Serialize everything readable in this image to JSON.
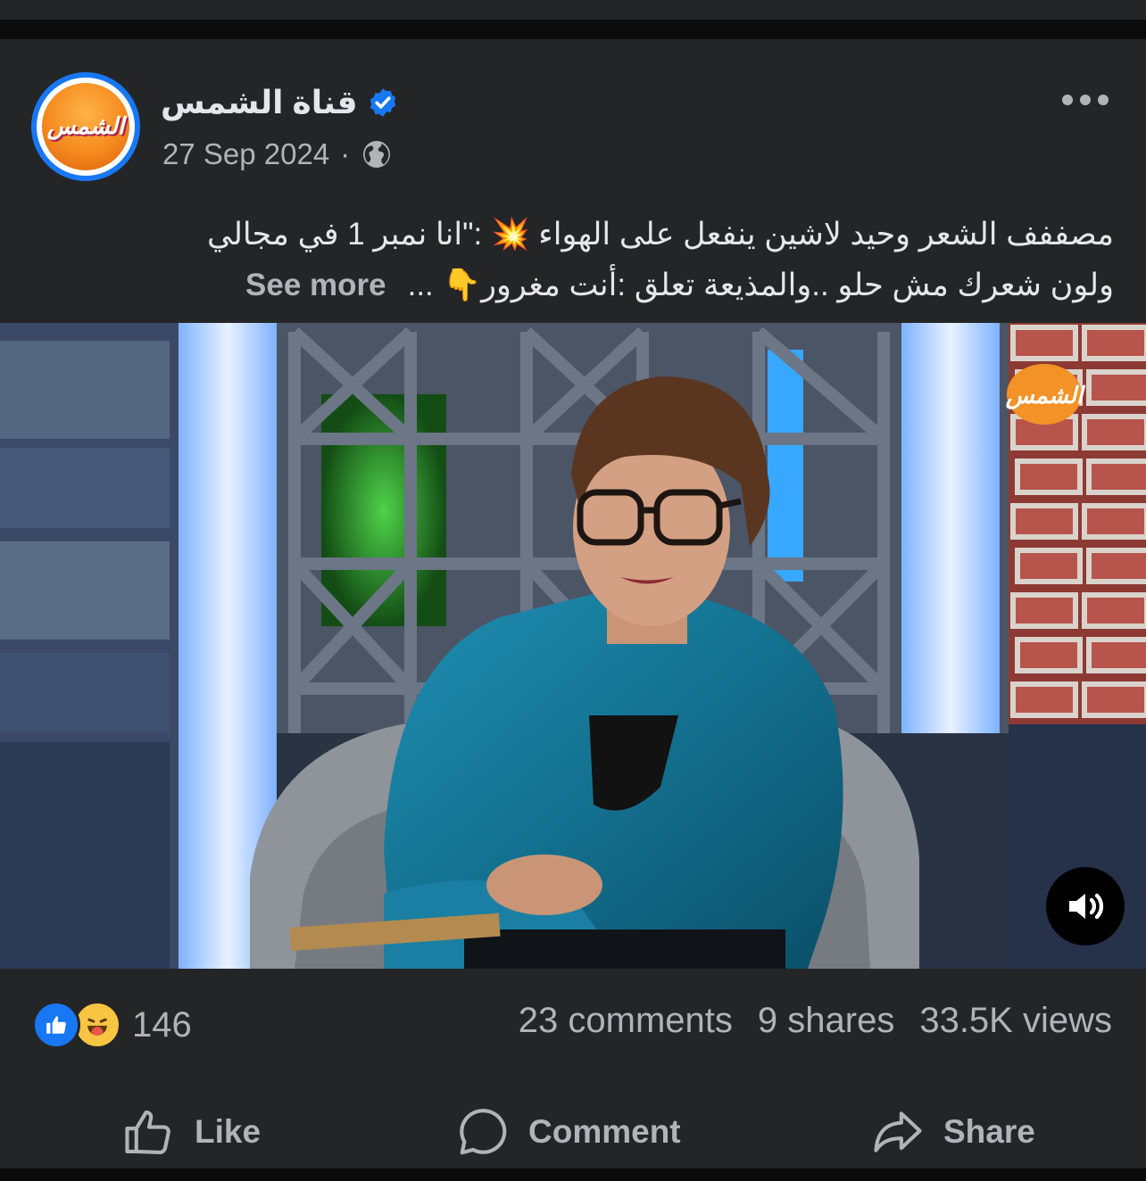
{
  "post": {
    "page_name": "قناة الشمس",
    "avatar_logo_text": "الشمس",
    "date": "27 Sep 2024",
    "separator": "·",
    "audience_icon": "globe-icon",
    "verified_icon": "verified-badge-icon",
    "caption_line1": "مصففف الشعر وحيد لاشين ينفعل على الهواء 💥 :\"انا نمبر 1 في مجالي",
    "caption_line2": "ولون شعرك مش حلو ..والمذيعة تعلق :أنت مغرور👇 ...",
    "see_more": "See more",
    "video": {
      "watermark_text": "الشمس",
      "sound_icon": "speaker-icon"
    }
  },
  "stats": {
    "reaction_icons": [
      "like-reaction-icon",
      "haha-reaction-icon"
    ],
    "reaction_count": "146",
    "comments": "23 comments",
    "shares": "9 shares",
    "views": "33.5K views"
  },
  "actions": {
    "like": "Like",
    "comment": "Comment",
    "share": "Share"
  },
  "colors": {
    "background": "#242526",
    "text_primary": "#e4e6eb",
    "text_secondary": "#b0b3b8",
    "accent": "#1877f2"
  }
}
